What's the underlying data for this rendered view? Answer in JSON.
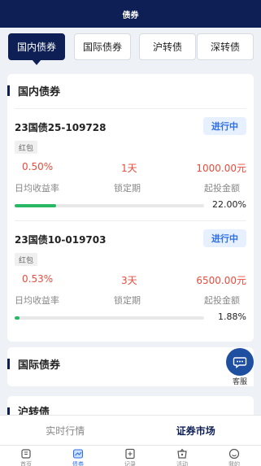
{
  "header": {
    "title": "债券"
  },
  "tabs": [
    {
      "label": "国内债券",
      "active": true
    },
    {
      "label": "国际债券",
      "active": false
    },
    {
      "label": "沪转债",
      "active": false
    },
    {
      "label": "深转债",
      "active": false
    }
  ],
  "domestic": {
    "title": "国内债券",
    "bonds": [
      {
        "name": "23国债25-109728",
        "status": "进行中",
        "tag": "红包",
        "yield": "0.50%",
        "yield_label": "日均收益率",
        "lock": "1天",
        "lock_label": "锁定期",
        "min_amount": "1000.00元",
        "min_label": "起投金额",
        "progress_text": "22.00%",
        "progress": 0.22
      },
      {
        "name": "23国债10-019703",
        "status": "进行中",
        "tag": "红包",
        "yield": "0.53%",
        "yield_label": "日均收益率",
        "lock": "3天",
        "lock_label": "锁定期",
        "min_amount": "6500.00元",
        "min_label": "起投金额",
        "progress_text": "1.88%",
        "progress": 0.0188
      }
    ]
  },
  "international": {
    "title": "国际债券"
  },
  "shanghai": {
    "title": "沪转债"
  },
  "service": {
    "label": "客服",
    "icon": "chat-icon"
  },
  "segment": [
    {
      "label": "实时行情",
      "active": false
    },
    {
      "label": "证券市场",
      "active": true
    }
  ],
  "tabbar": [
    {
      "label": "首页",
      "icon": "home-icon"
    },
    {
      "label": "债券",
      "icon": "bond-icon",
      "active": true
    },
    {
      "label": "记录",
      "icon": "record-icon"
    },
    {
      "label": "活动",
      "icon": "gift-icon"
    },
    {
      "label": "我的",
      "icon": "user-icon"
    }
  ],
  "colors": {
    "primary": "#0d1f54",
    "rise": "#e74c3c",
    "status_bg": "#e7f0ff",
    "status_text": "#2f6fe8",
    "progress": "#27b765"
  }
}
